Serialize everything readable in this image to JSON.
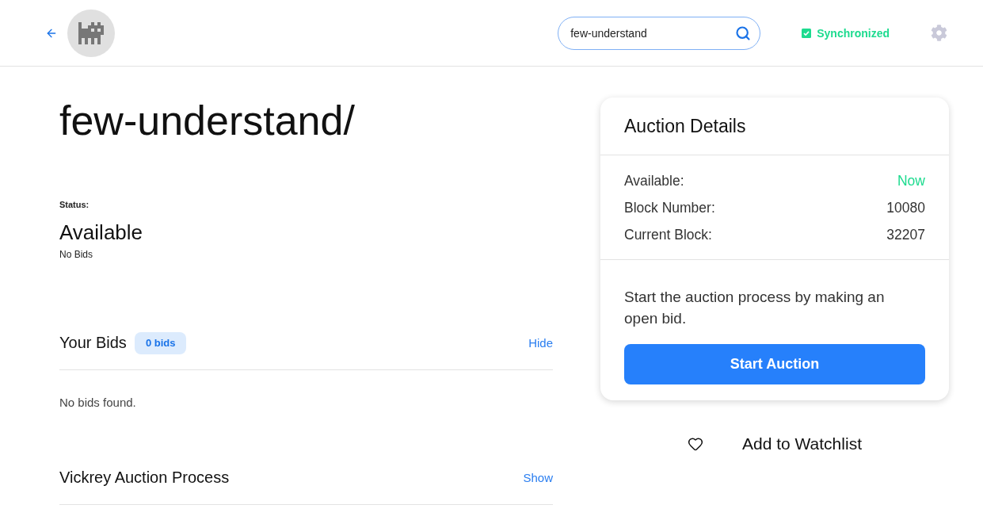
{
  "header": {
    "search": {
      "value": "few-understand"
    },
    "sync": {
      "label": "Synchronized",
      "checked": true
    }
  },
  "domain": {
    "title": "few-understand/",
    "status_label": "Status:",
    "status": "Available",
    "bids_note": "No Bids"
  },
  "sections": [
    {
      "title": "Your Bids",
      "badge": "0 bids",
      "toggle": "Hide",
      "body": "No bids found."
    },
    {
      "title": "Vickrey Auction Process",
      "toggle": "Show"
    }
  ],
  "auction_details": {
    "title": "Auction Details",
    "rows": [
      {
        "label": "Available:",
        "value": "Now",
        "kind": "status"
      },
      {
        "label": "Block Number:",
        "value": "10080",
        "kind": "plain"
      },
      {
        "label": "Current Block:",
        "value": "32207",
        "kind": "plain"
      }
    ],
    "description": "Start the auction process by making an open bid.",
    "button": "Start Auction"
  },
  "watchlist": {
    "label": "Add to Watchlist",
    "watched": false
  }
}
